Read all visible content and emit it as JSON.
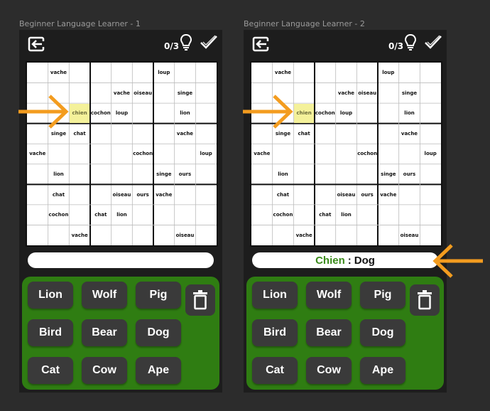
{
  "frames": [
    {
      "label": "Beginner Language Learner - 1",
      "score": "0/3",
      "answer": {
        "french": "",
        "separator": "",
        "english": ""
      }
    },
    {
      "label": "Beginner Language Learner - 2",
      "score": "0/3",
      "answer": {
        "french": "Chien",
        "separator": ":",
        "english": "Dog"
      }
    }
  ],
  "icons": {
    "exit": "exit-icon",
    "hint": "lightbulb-icon",
    "submit": "check-icon",
    "delete": "trash-icon",
    "pointer": "arrow-icon"
  },
  "colors": {
    "background": "#2c2c2c",
    "phone": "#1d1d1d",
    "keyboard": "#2f7d12",
    "key": "#3a3a3a",
    "highlight": "#f4f19a",
    "french_word": "#3a8a1a",
    "arrow": "#f39c1f"
  },
  "grid": [
    [
      "",
      "vache",
      "",
      "",
      "",
      "",
      "loup",
      "",
      ""
    ],
    [
      "",
      "",
      "",
      "",
      "vache",
      "oiseau",
      "",
      "singe",
      ""
    ],
    [
      "",
      "",
      "chien",
      "cochon",
      "loup",
      "",
      "",
      "lion",
      ""
    ],
    [
      "",
      "singe",
      "chat",
      "",
      "",
      "",
      "",
      "vache",
      ""
    ],
    [
      "vache",
      "",
      "",
      "",
      "",
      "cochon",
      "",
      "",
      "loup"
    ],
    [
      "",
      "lion",
      "",
      "",
      "",
      "",
      "singe",
      "ours",
      ""
    ],
    [
      "",
      "chat",
      "",
      "",
      "oiseau",
      "ours",
      "vache",
      "",
      ""
    ],
    [
      "",
      "cochon",
      "",
      "chat",
      "lion",
      "",
      "",
      "",
      ""
    ],
    [
      "",
      "",
      "vache",
      "",
      "",
      "",
      "",
      "oiseau",
      ""
    ]
  ],
  "keys": [
    "Lion",
    "Wolf",
    "Pig",
    "Bird",
    "Bear",
    "Dog",
    "Cat",
    "Cow",
    "Ape"
  ]
}
